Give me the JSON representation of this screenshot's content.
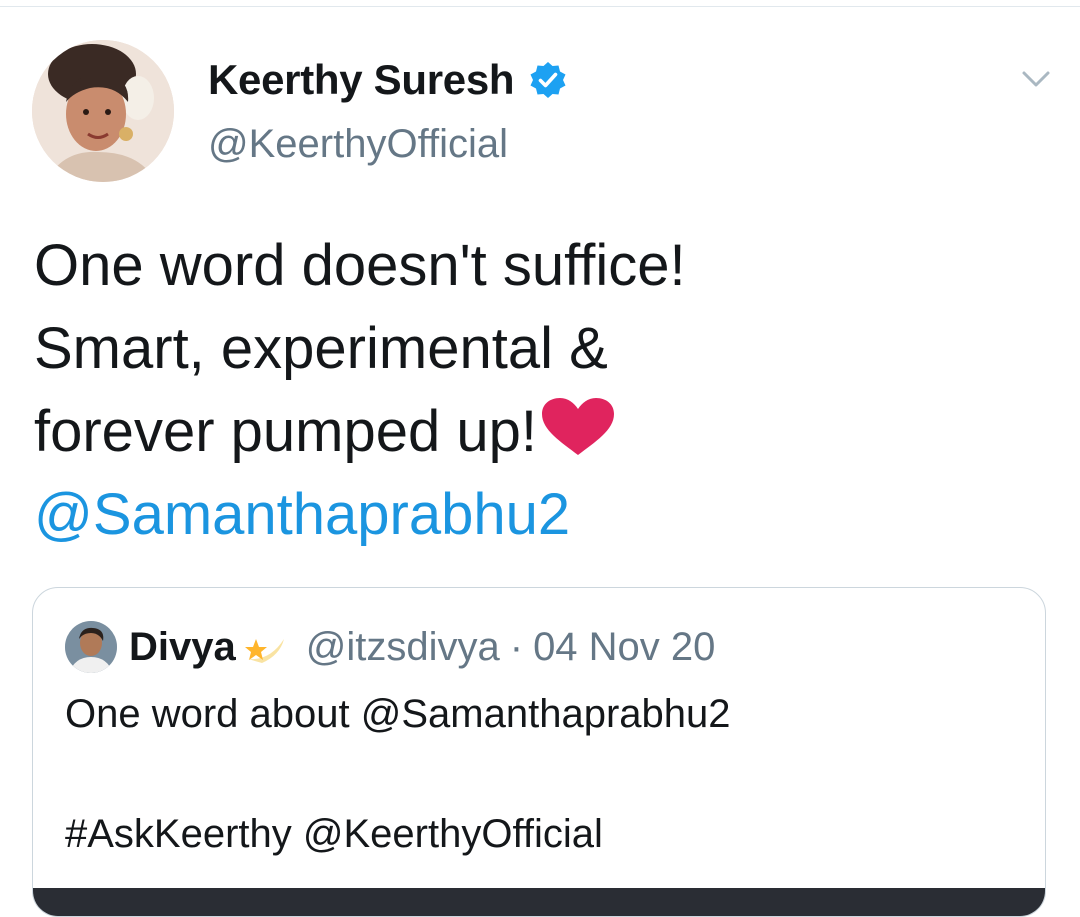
{
  "tweet": {
    "author": {
      "name": "Keerthy Suresh",
      "handle": "@KeerthyOfficial",
      "verified": true,
      "avatar_icon": "profile-photo"
    },
    "text_lines": [
      "One word doesn't suffice!",
      "Smart, experimental &",
      "forever pumped up!"
    ],
    "heart_emoji": "red-heart-icon",
    "mention": "@Samanthaprabhu2",
    "menu_icon": "chevron-down-icon"
  },
  "quoted_tweet": {
    "author_name": "Divya",
    "name_emoji": "shooting-star-icon",
    "handle": "@itzsdivya",
    "separator": "·",
    "date": "04 Nov 20",
    "text_lines": [
      "One word about @Samanthaprabhu2",
      "",
      "#AskKeerthy @KeerthyOfficial"
    ]
  },
  "colors": {
    "link": "#1b95e0",
    "verified": "#1da1f2",
    "secondary_text": "#657786",
    "heart": "#e0245e"
  }
}
